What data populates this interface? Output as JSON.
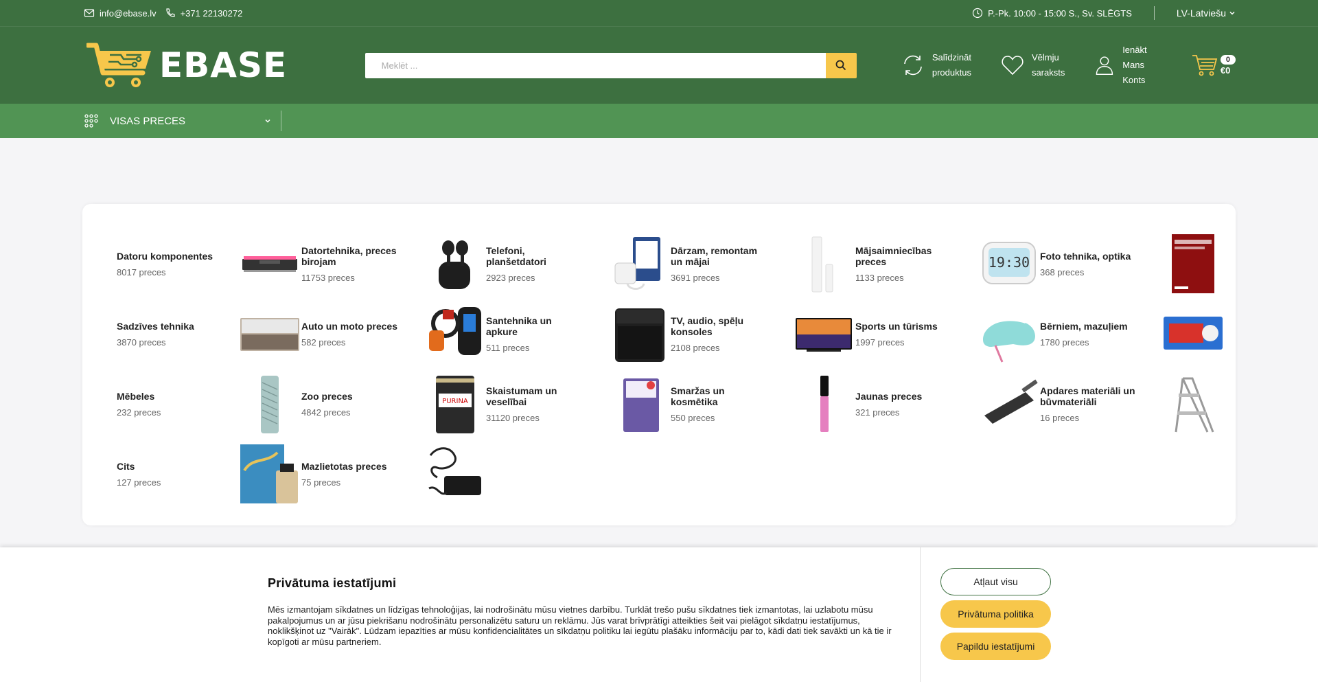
{
  "topbar": {
    "email": "info@ebase.lv",
    "phone": "+371 22130272",
    "hours": "P.-Pk. 10:00 - 15:00 S., Sv. SLĒGTS",
    "language": "LV-Latviešu"
  },
  "header": {
    "logo_text": "EBASE",
    "search_placeholder": "Meklēt ...",
    "compare_line1": "Salīdzināt",
    "compare_line2": "produktus",
    "wishlist_line1": "Vēlmju",
    "wishlist_line2": "saraksts",
    "account_line1": "Ienākt",
    "account_line2": "Mans Konts",
    "cart_count": "0",
    "cart_amount": "€0"
  },
  "nav": {
    "all_products": "VISAS PRECES"
  },
  "categories": [
    {
      "name": "Datoru komponentes",
      "count": "8017 preces",
      "icon": "ram-icon"
    },
    {
      "name": "Datortehnika, preces birojam",
      "count": "11753 preces",
      "icon": "earbuds-icon"
    },
    {
      "name": "Telefoni, planšetdatori",
      "count": "2923 preces",
      "icon": "charger-icon"
    },
    {
      "name": "Dārzam, remontam un mājai",
      "count": "3691 preces",
      "icon": "sensor-icon"
    },
    {
      "name": "Mājsaimniecības preces",
      "count": "1133 preces",
      "icon": "clock-icon"
    },
    {
      "name": "Foto tehnika, optika",
      "count": "368 preces",
      "icon": "photo-paper-icon"
    },
    {
      "name": "Sadzīves tehnika",
      "count": "3870 preces",
      "icon": "dishwasher-icon"
    },
    {
      "name": "Auto un moto preces",
      "count": "582 preces",
      "icon": "ev-charger-icon"
    },
    {
      "name": "Santehnika un apkure",
      "count": "511 preces",
      "icon": "humidifier-icon"
    },
    {
      "name": "TV, audio, spēļu konsoles",
      "count": "2108 preces",
      "icon": "tv-icon"
    },
    {
      "name": "Sports un tūrisms",
      "count": "1997 preces",
      "icon": "helmet-icon"
    },
    {
      "name": "Bērniem, mazuļiem",
      "count": "1780 preces",
      "icon": "toy-box-icon"
    },
    {
      "name": "Mēbeles",
      "count": "232 preces",
      "icon": "mattress-icon"
    },
    {
      "name": "Zoo preces",
      "count": "4842 preces",
      "icon": "pet-food-can-icon"
    },
    {
      "name": "Skaistumam un veselībai",
      "count": "31120 preces",
      "icon": "supplement-box-icon"
    },
    {
      "name": "Smaržas un kosmētika",
      "count": "550 preces",
      "icon": "lip-gloss-icon"
    },
    {
      "name": "Jaunas preces",
      "count": "321 preces",
      "icon": "scraper-icon"
    },
    {
      "name": "Apdares materiāli un būvmateriāli",
      "count": "16 preces",
      "icon": "step-ladder-icon"
    },
    {
      "name": "Cits",
      "count": "127 preces",
      "icon": "perfume-gift-icon"
    },
    {
      "name": "Mazlietotas preces",
      "count": "75 preces",
      "icon": "power-adapter-icon"
    }
  ],
  "cookie": {
    "title": "Privātuma iestatījumi",
    "text": "Mēs izmantojam sīkdatnes un līdzīgas tehnoloģijas, lai nodrošinātu mūsu vietnes darbību. Turklāt trešo pušu sīkdatnes tiek izmantotas, lai uzlabotu mūsu pakalpojumus un ar jūsu piekrišanu nodrošinātu personalizētu saturu un reklāmu. Jūs varat brīvprātīgi atteikties šeit vai pielāgot sīkdatņu iestatījumus, noklikšķinot uz \"Vairāk\". Lūdzam iepazīties ar mūsu konfidencialitātes un sīkdatņu politiku lai iegūtu plašāku informāciju par to, kādi dati tiek savākti un kā tie ir kopīgoti ar mūsu partneriem.",
    "allow_all": "Atļaut visu",
    "privacy_policy": "Privātuma politika",
    "more_settings": "Papildu iestatījumi"
  },
  "colors": {
    "header_green": "#3d7040",
    "nav_green": "#519454",
    "accent_yellow": "#f7c74b"
  }
}
